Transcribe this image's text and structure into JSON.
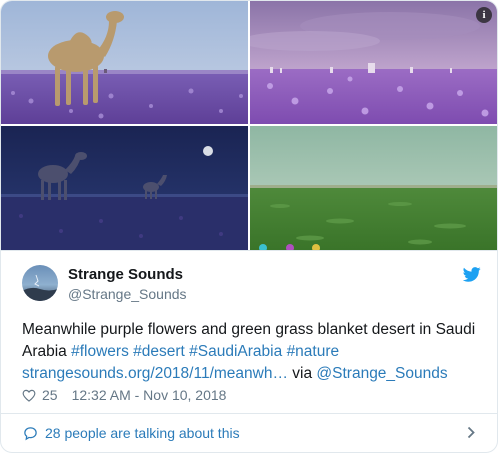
{
  "media": {
    "info_icon": "info-icon",
    "info_glyph": "i",
    "colors": {
      "lavender": "#8a5fc0",
      "grass": "#3d7a2e",
      "night_sky": "#1e2a5e"
    }
  },
  "author": {
    "name": "Strange Sounds",
    "handle": "@Strange_Sounds"
  },
  "tweet": {
    "text_intro": "Meanwhile purple flowers and green grass blanket desert in Saudi Arabia ",
    "hashtag_flowers": "#flowers",
    "hashtag_desert": "#desert",
    "hashtag_saudiarabia": "#SaudiArabia",
    "hashtag_nature": "#nature",
    "url": "strangesounds.org/2018/11/meanwh…",
    "via_label": " via ",
    "via_mention": "@Strange_Sounds"
  },
  "meta": {
    "like_count": "25",
    "timestamp": "12:32 AM - Nov 10, 2018"
  },
  "footer": {
    "talking_text": "28 people are talking about this"
  },
  "colors": {
    "link": "#2b7bb9",
    "twitter_blue": "#1da1f2",
    "secondary_text": "#657786",
    "border": "#e1e8ed"
  }
}
